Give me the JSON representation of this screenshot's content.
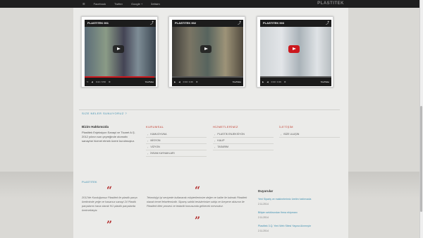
{
  "nav": {
    "items": [
      "☰",
      "Facebook",
      "Twitter",
      "Google +",
      "İletisim"
    ],
    "brand": "PLASTITEK"
  },
  "videos": [
    {
      "title": "PLASTITEK 001",
      "time": "0:22 / 0:50",
      "progress": 0.98,
      "play_style": "dark"
    },
    {
      "title": "PLASTITEK 002",
      "time": "0:00 / 0:46",
      "progress": 0,
      "play_style": "dark"
    },
    {
      "title": "PLASTITEK 003",
      "time": "0:00 / 0:49",
      "progress": 0,
      "play_style": "red"
    }
  ],
  "player": {
    "youtube_label": "YouTube"
  },
  "services_heading": "SIZE NELER SUNUYORUZ ?",
  "about": {
    "title": "Bizim Hakkımızda",
    "text": "Plastitek Enjeksiyon Sanayi ve Ticaret A.Ş. 2012 yılının son çeyreğinde otomotiv sanayine hizmet etmek üzere kurulmuştur."
  },
  "columns": [
    {
      "title": "KURUMSAL",
      "items": [
        "KAMUOYUNA",
        "MİSYON",
        "VİZYON",
        "İNSAN KAYNAKLARI"
      ]
    },
    {
      "title": "HİZMETLERİMİZ",
      "items": [
        "PLASTİK ENJEKSİYON",
        "KALIP",
        "TASARIM"
      ]
    },
    {
      "title": "İLETİŞİM",
      "items": [
        "BİZE ULAŞIN"
      ]
    }
  ],
  "band_heading": "PLASTITEK",
  "quotes": [
    {
      "text": "2012'de Kurduğumuz Plastitek ile plastik parça üretiminde yeğe ve hasarsız sanayi 24 Plastik parçalarını hava olarak %1 plastik parçalarda üretmekteyiz."
    },
    {
      "text": "Teknolojiyi iyi seviyede kullanarak müşterilerimize değer ve kalite ile kalmak Plastitek olarak temel felsefemizdir. Siparış sahibi tesislerimize sahip ve üreyene akisının ile Plastitek tiletr prosesi ve tedariki konusunda gelirecek mevcuttur."
    }
  ],
  "news": {
    "title": "Duyurular",
    "items": [
      {
        "title": "Yeni Sipariş ve makinelerimiz üretim hattımızda",
        "date": "2.11.2014"
      },
      {
        "title": "Bilişim sektörundan firma ekipmanı",
        "date": "2.11.2014"
      },
      {
        "title": "Plastitek 3.Q. Yeni Web Sitesi Yayına Alınmıştır",
        "date": "2.11.2014"
      }
    ]
  },
  "colors": {
    "accent_blue": "#3d8fb0",
    "accent_red": "#c0392b",
    "youtube_red": "#cc181e"
  }
}
